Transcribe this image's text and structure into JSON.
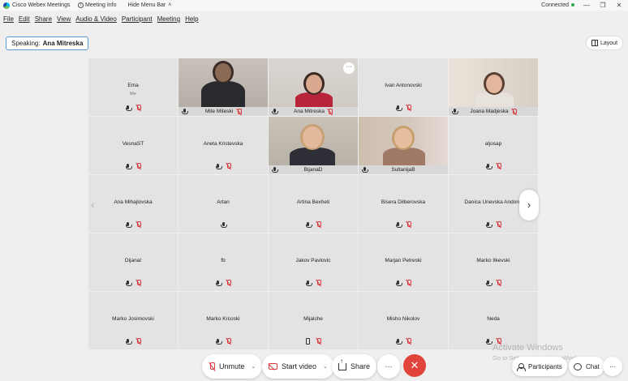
{
  "titlebar": {
    "app_name": "Cisco Webex Meetings",
    "meeting_info": "Meeting Info",
    "hide_menu_bar": "Hide Menu Bar",
    "status": "Connected"
  },
  "menu": [
    "File",
    "Edit",
    "Share",
    "View",
    "Audio & Video",
    "Participant",
    "Meeting",
    "Help"
  ],
  "speaking": {
    "label": "Speaking:",
    "name": "Ana Mitreska"
  },
  "layout_label": "Layout",
  "tiles": [
    {
      "name": "Ema",
      "sub": "Me",
      "type": "audio",
      "mic": "muted",
      "device": "mic"
    },
    {
      "name": "Mite Miteski",
      "type": "video",
      "mic": "muted"
    },
    {
      "name": "Ana Mitreska",
      "type": "video",
      "mic": "muted",
      "active": true
    },
    {
      "name": "Ivan Antonovski",
      "type": "audio",
      "mic": "muted",
      "device": "mic"
    },
    {
      "name": "Joana Madjeska",
      "type": "video",
      "mic": "muted"
    },
    {
      "name": "VesnaST",
      "type": "audio",
      "mic": "muted",
      "device": "mic"
    },
    {
      "name": "Aneta Kristevska",
      "type": "audio",
      "mic": "muted",
      "device": "mic"
    },
    {
      "name": "BijanaD",
      "type": "video",
      "mic": "none"
    },
    {
      "name": "SultanijaB",
      "type": "video",
      "mic": "none"
    },
    {
      "name": "aljosap",
      "type": "audio",
      "mic": "muted",
      "device": "mic"
    },
    {
      "name": "Ana Mihajlovska",
      "type": "audio",
      "mic": "muted",
      "device": "mic"
    },
    {
      "name": "Artan",
      "type": "audio",
      "mic": "none",
      "device": "mic"
    },
    {
      "name": "Artina Bexheti",
      "type": "audio",
      "mic": "muted",
      "device": "mic"
    },
    {
      "name": "Bisera Dilberovska",
      "type": "audio",
      "mic": "muted",
      "device": "mic"
    },
    {
      "name": "Danica Unevska Andono",
      "type": "audio",
      "mic": "muted",
      "device": "mic"
    },
    {
      "name": "DijanaI",
      "type": "audio",
      "mic": "muted",
      "device": "mic"
    },
    {
      "name": "fb",
      "type": "audio",
      "mic": "muted",
      "device": "mic"
    },
    {
      "name": "Jakov Pavlovic",
      "type": "audio",
      "mic": "muted",
      "device": "mic"
    },
    {
      "name": "Marjan Petreski",
      "type": "audio",
      "mic": "muted",
      "device": "mic"
    },
    {
      "name": "Marko Ilkevski",
      "type": "audio",
      "mic": "muted",
      "device": "mic"
    },
    {
      "name": "Marko Josimovski",
      "type": "audio",
      "mic": "muted",
      "device": "mic"
    },
    {
      "name": "Marko Krcoski",
      "type": "audio",
      "mic": "muted",
      "device": "mic"
    },
    {
      "name": "Mijalche",
      "type": "audio",
      "mic": "muted",
      "device": "phone"
    },
    {
      "name": "Misho Nikolov",
      "type": "audio",
      "mic": "muted",
      "device": "mic"
    },
    {
      "name": "Neda",
      "type": "audio",
      "mic": "muted",
      "device": "mic"
    }
  ],
  "toolbar": {
    "unmute": "Unmute",
    "start_video": "Start video",
    "share": "Share",
    "more": "···",
    "end": "✕",
    "participants": "Participants",
    "chat": "Chat"
  },
  "watermark": {
    "line1": "Activate Windows",
    "line2": "Go to Settings to activate Windows."
  },
  "colors": {
    "accent": "#4fb3e8",
    "muted_red": "#d9363e",
    "end_call": "#e0443a",
    "connected_green": "#2bab4c"
  }
}
